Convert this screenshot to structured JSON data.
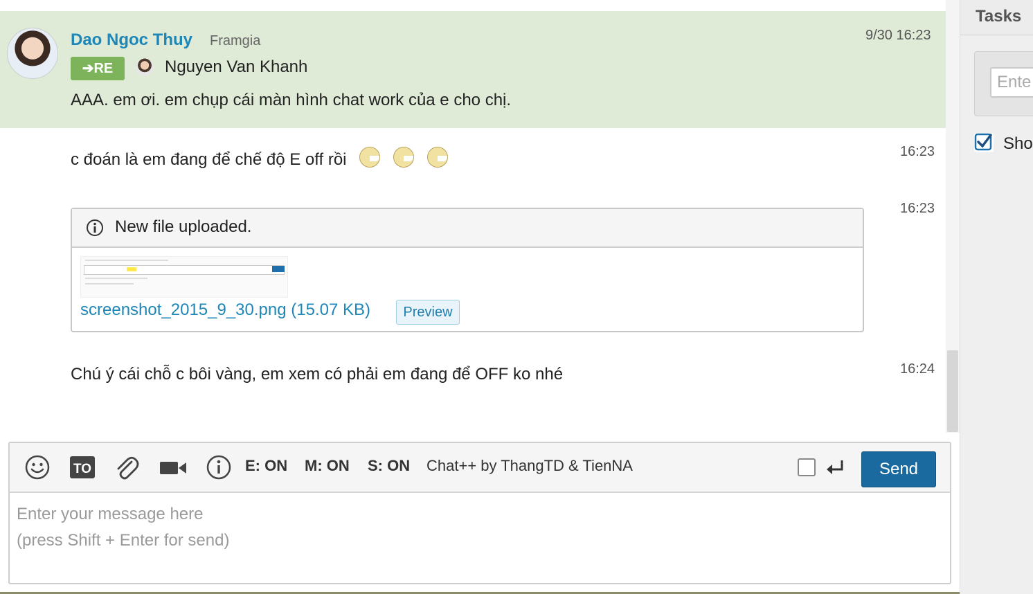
{
  "messages": {
    "highlighted": {
      "sender": "Dao Ngoc Thuy",
      "org": "Framgia",
      "time": "9/30 16:23",
      "re_label": "RE",
      "re_to": "Nguyen Van Khanh",
      "text": "AAA. em ơi. em chụp cái màn hình chat work của e cho chị."
    },
    "msg2": {
      "text": "c đoán là em đang để chế độ E off rồi",
      "time": "16:23",
      "emoticons": [
        "emoticon-icon",
        "emoticon-icon",
        "emoticon-icon"
      ]
    },
    "file": {
      "time": "16:23",
      "title": "New file uploaded.",
      "link": "screenshot_2015_9_30.png (15.07 KB)",
      "preview_label": "Preview"
    },
    "msg4": {
      "text": "Chú ý cái chỗ c bôi vàng, em xem có phải em đang để OFF ko nhé",
      "time": "16:24"
    }
  },
  "composer": {
    "toolbar": {
      "e_status": "E: ON",
      "m_status": "M: ON",
      "s_status": "S: ON",
      "credit": "Chat++ by ThangTD & TienNA",
      "send_label": "Send"
    },
    "placeholder": "Enter your message here\n(press Shift + Enter for send)"
  },
  "sidebar": {
    "title": "Tasks",
    "input_placeholder": "Ente",
    "checkbox_label": "Sho"
  },
  "colors": {
    "accent": "#1e87b7",
    "highlight_bg": "#dfebd7",
    "re_badge": "#7cb35b",
    "send_button": "#1a6aa0"
  }
}
